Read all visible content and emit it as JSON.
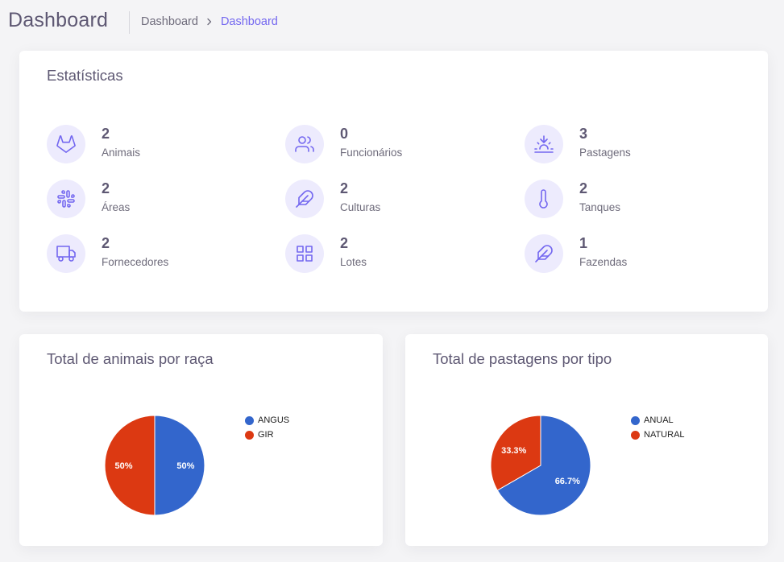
{
  "header": {
    "title": "Dashboard",
    "breadcrumb": [
      "Dashboard",
      "Dashboard"
    ]
  },
  "stats": {
    "title": "Estatísticas",
    "items": [
      {
        "value": "2",
        "label": "Animais",
        "icon": "gitlab-icon"
      },
      {
        "value": "0",
        "label": "Funcionários",
        "icon": "users-icon"
      },
      {
        "value": "3",
        "label": "Pastagens",
        "icon": "sunrise-icon"
      },
      {
        "value": "2",
        "label": "Áreas",
        "icon": "slack-icon"
      },
      {
        "value": "2",
        "label": "Culturas",
        "icon": "feather-icon"
      },
      {
        "value": "2",
        "label": "Tanques",
        "icon": "thermometer-icon"
      },
      {
        "value": "2",
        "label": "Fornecedores",
        "icon": "truck-icon"
      },
      {
        "value": "2",
        "label": "Lotes",
        "icon": "grid-icon"
      },
      {
        "value": "1",
        "label": "Fazendas",
        "icon": "feather-icon"
      }
    ]
  },
  "colors": {
    "accent": "#7367f0",
    "blue": "#3366cc",
    "red": "#dc3912"
  },
  "chart_data": [
    {
      "type": "pie",
      "title": "Total de animais por raça",
      "categories": [
        "ANGUS",
        "GIR"
      ],
      "values": [
        1,
        1
      ],
      "labels": [
        "50%",
        "50%"
      ],
      "colors": [
        "#3366cc",
        "#dc3912"
      ],
      "legend": "right"
    },
    {
      "type": "pie",
      "title": "Total de pastagens por tipo",
      "categories": [
        "ANUAL",
        "NATURAL"
      ],
      "values": [
        2,
        1
      ],
      "labels": [
        "66.7%",
        "33.3%"
      ],
      "colors": [
        "#3366cc",
        "#dc3912"
      ],
      "legend": "right"
    }
  ]
}
